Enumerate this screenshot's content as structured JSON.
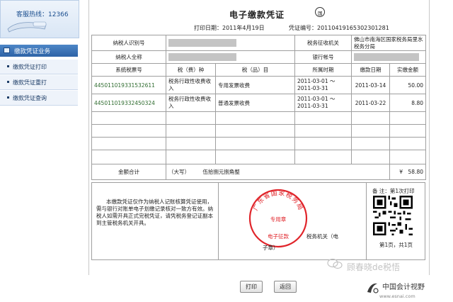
{
  "sidebar": {
    "hotline": "客服热线：12366",
    "menu_title": "缴款凭证业务",
    "items": [
      {
        "label": "缴款凭证打印"
      },
      {
        "label": "缴款凭证重打"
      },
      {
        "label": "缴款凭证查询"
      }
    ]
  },
  "voucher": {
    "title": "电子缴款凭证",
    "print_date": "打印日期：2011年4月19日",
    "voucher_no": "凭证编号：20110419165302301281",
    "labels": {
      "taxpayer_id": "纳税人识别号",
      "taxpayer_name": "纳税人全称",
      "collector": "税务征收机关",
      "bank_account": "银行帐号",
      "system_tax_no": "系统税票号",
      "tax_type": "税（费）种",
      "tax_item": "税（品）目",
      "period": "所属时期",
      "pay_date": "缴款日期",
      "amount": "实缴金额",
      "total": "金额合计",
      "big_write": "（大写）"
    },
    "collector_value": "佛山市南海区国家税务局里水税务分局",
    "rows": [
      {
        "no": "445011019331532611",
        "type": "税务行政性收费收入",
        "item": "专用发票收费",
        "period": "2011-03-01 ～ 2011-03-31",
        "date": "2011-03-14",
        "amount": "50.00"
      },
      {
        "no": "445011019332450324",
        "type": "税务行政性收费收入",
        "item": "普通发票收费",
        "period": "2011-03-01 ～ 2011-03-31",
        "date": "2011-03-22",
        "amount": "8.80"
      }
    ],
    "total_cn": "伍拾捌元捌角整",
    "total_amount": "¥　58.80",
    "notice": "本缴款凭证仅作为纳税人记账核算凭证使用，需与银行对账单电子划缴记录核对一致方有效。纳税人如需开具正式完税凭证，请凭税务登记证副本到主管税务机关开具。",
    "stamp_outer": "广东省国家税务局",
    "stamp_inner": "专用章",
    "stamp_bottom": "电子征款",
    "tax_office_a": "税务机关（电",
    "tax_office_b": "子章）",
    "remark": "备 注：第1次打印",
    "page": "第1页，共1页"
  },
  "buttons": {
    "print": "打印",
    "back": "返回"
  },
  "watermark": {
    "wechat": "顾春晓de税悟",
    "site_cn": "中国会计视野",
    "site_url": "www.esnai.com"
  }
}
